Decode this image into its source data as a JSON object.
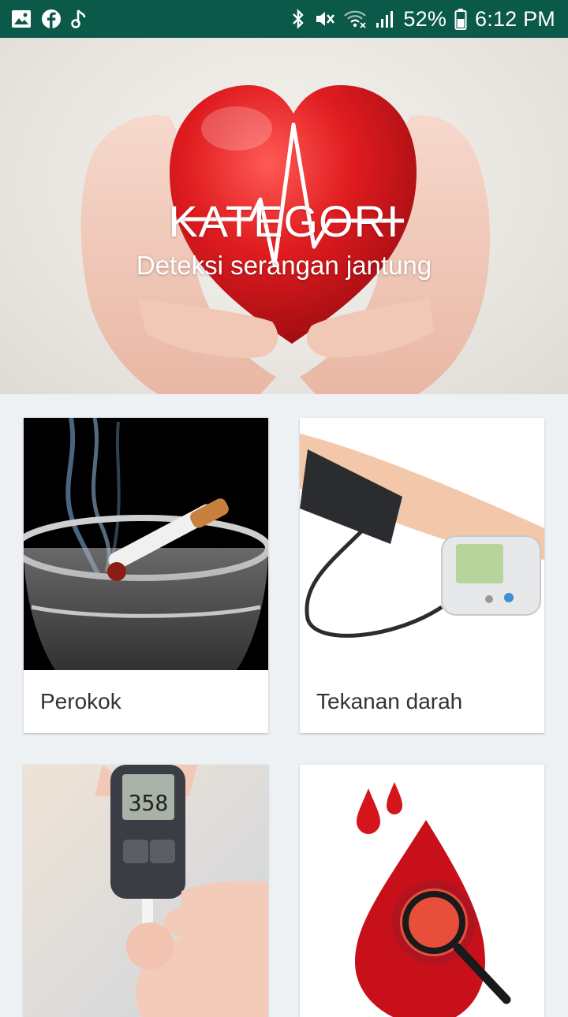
{
  "status_bar": {
    "icons_left": [
      "gallery-icon",
      "facebook-icon",
      "music-note-icon"
    ],
    "icons_right": [
      "bluetooth-icon",
      "vibrate-mute-icon",
      "wifi-icon",
      "signal-icon",
      "battery-icon"
    ],
    "battery": "52%",
    "time": "6:12 PM"
  },
  "hero": {
    "title": "KATEGORI",
    "subtitle": "Deteksi serangan jantung"
  },
  "categories": [
    {
      "label": "Perokok",
      "image": "cigarette-ashtray-image"
    },
    {
      "label": "Tekanan darah",
      "image": "blood-pressure-monitor-image"
    },
    {
      "label": "",
      "image": "glucose-meter-image"
    },
    {
      "label": "",
      "image": "blood-drop-magnifier-image"
    }
  ],
  "colors": {
    "status_bar": "#0b5a49",
    "heart": "#d4161c",
    "background": "#eef1f4"
  }
}
